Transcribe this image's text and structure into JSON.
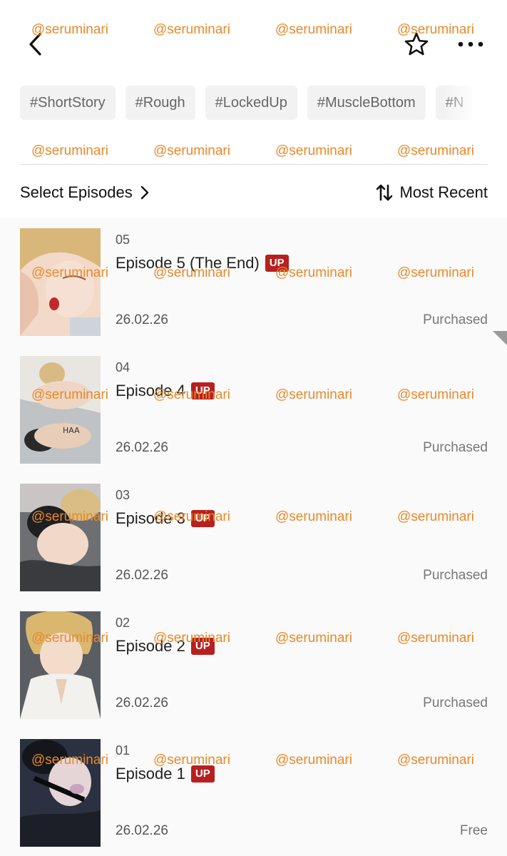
{
  "header": {
    "back_icon": "chevron-left-icon",
    "favorite_icon": "star-outline-icon",
    "more_icon": "more-horizontal-icon"
  },
  "tags": [
    "#ShortStory",
    "#Rough",
    "#LockedUp",
    "#MuscleBottom",
    "#N"
  ],
  "episodes_bar": {
    "select_label": "Select Episodes",
    "sort_label": "Most Recent",
    "sort_icon": "sort-arrows-icon"
  },
  "episodes": [
    {
      "number": "05",
      "title": "Episode 5 (The End)",
      "badge": "UP",
      "date": "26.02.26",
      "status": "Purchased"
    },
    {
      "number": "04",
      "title": "Episode 4",
      "badge": "UP",
      "date": "26.02.26",
      "status": "Purchased"
    },
    {
      "number": "03",
      "title": "Episode 3",
      "badge": "UP",
      "date": "26.02.26",
      "status": "Purchased"
    },
    {
      "number": "02",
      "title": "Episode 2",
      "badge": "UP",
      "date": "26.02.26",
      "status": "Purchased"
    },
    {
      "number": "01",
      "title": "Episode 1",
      "badge": "UP",
      "date": "26.02.26",
      "status": "Free"
    }
  ],
  "watermark": "@seruminari",
  "colors": {
    "accent_badge": "#b8201f",
    "watermark": "#e9892a",
    "tag_bg": "#f2f2f2"
  }
}
